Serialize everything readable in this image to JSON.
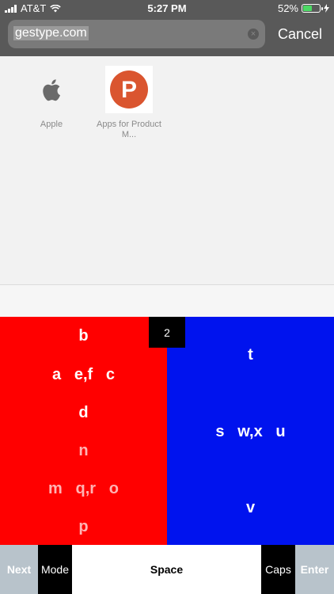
{
  "status_bar": {
    "carrier": "AT&T",
    "time": "5:27 PM",
    "battery_percent": "52%",
    "battery_level": 0.52
  },
  "url_bar": {
    "value": "gestype.com",
    "cancel_label": "Cancel"
  },
  "favorites": [
    {
      "label": "Apple",
      "icon": "apple-logo-icon"
    },
    {
      "label": "Apps for Product M...",
      "icon": "product-hunt-icon",
      "glyph": "P"
    }
  ],
  "keyboard": {
    "mode_indicator": "2",
    "left_pane": {
      "rows": [
        "b",
        "a   e,f   c",
        "d",
        "n",
        "m   q,r   o",
        "p"
      ]
    },
    "right_pane": {
      "rows": [
        "t",
        "s   w,x   u",
        "v"
      ]
    },
    "colors": {
      "left": "#ff0000",
      "right": "#0013ee"
    }
  },
  "bottom_row": {
    "next": "Next",
    "mode": "Mode",
    "space": "Space",
    "caps": "Caps",
    "enter": "Enter"
  }
}
